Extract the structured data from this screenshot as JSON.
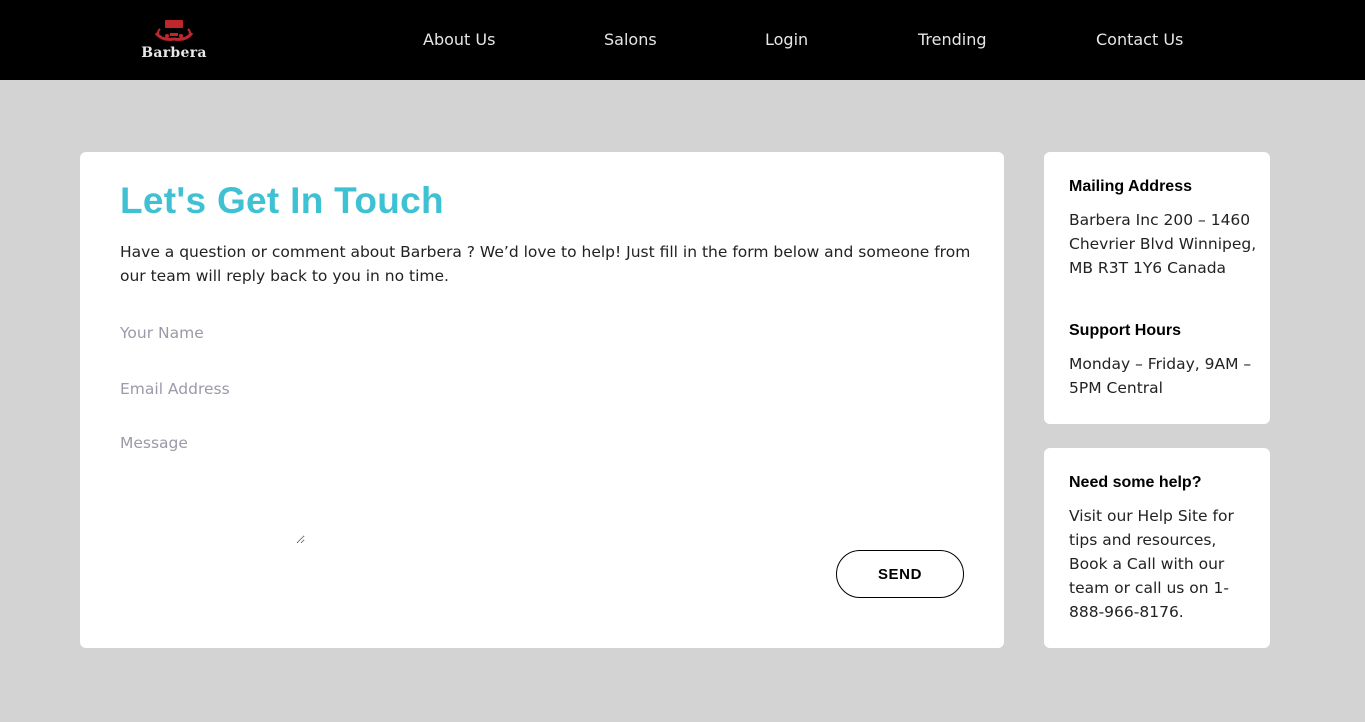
{
  "header": {
    "logo_text": "Barbera",
    "nav": [
      "About Us",
      "Salons",
      "Login",
      "Trending",
      "Contact Us"
    ]
  },
  "contact": {
    "title": "Let's Get In Touch",
    "intro": "Have a question or comment about Barbera ? We’d love to help! Just fill in the form below and someone from our team will reply back to you in no time.",
    "form": {
      "name_placeholder": "Your Name",
      "email_placeholder": "Email Address",
      "message_placeholder": "Message",
      "send_label": "SEND"
    }
  },
  "sidebar": {
    "mailing_title": "Mailing Address",
    "mailing_address": "Barbera Inc 200 – 1460 Chevrier Blvd Winnipeg, MB R3T 1Y6 Canada",
    "hours_title": "Support Hours",
    "hours_text": "Monday – Friday, 9AM – 5PM Central",
    "help_title": "Need some help?",
    "help_text": "Visit our Help Site for tips and resources, Book a Call with our team or call us on 1-888-966-8176."
  },
  "colors": {
    "accent": "#3fc1d4",
    "nav_background": "#000000",
    "page_background": "#d3d3d3",
    "logo_red": "#c0272d"
  },
  "icons": {
    "logo": "barbershop-logo-icon"
  }
}
